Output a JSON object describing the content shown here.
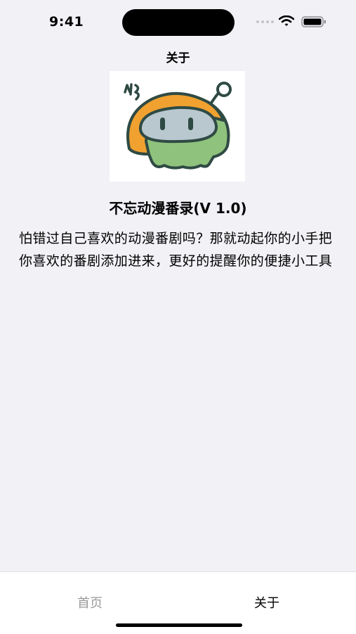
{
  "status_bar": {
    "time": "9:41"
  },
  "nav": {
    "title": "关于"
  },
  "app": {
    "name": "不忘动漫番录(V 1.0)",
    "description": "怕错过自己喜欢的动漫番剧吗？那就动起你的小手把你喜欢的番剧添加进来，更好的提醒你的便捷小工具"
  },
  "tab_bar": {
    "tabs": [
      {
        "label": "首页",
        "selected": false
      },
      {
        "label": "关于",
        "selected": true
      }
    ]
  },
  "colors": {
    "background": "#f2f1f6",
    "logo_orange": "#f0a12f",
    "logo_green": "#8fc27c",
    "logo_face": "#b9c8cf",
    "inactive_tab": "#9a9a9a"
  }
}
